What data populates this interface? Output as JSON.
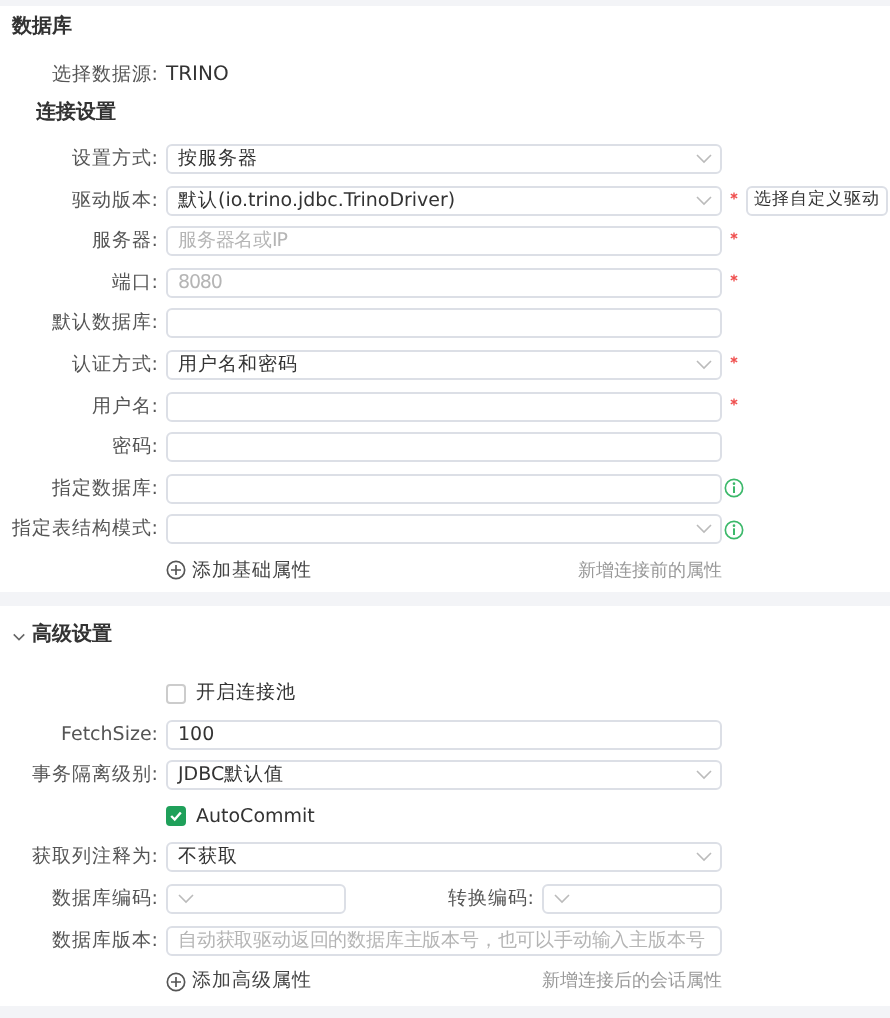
{
  "section_title": "数据库",
  "datasource": {
    "label": "选择数据源:",
    "value": "TRINO"
  },
  "connection": {
    "title": "连接设置",
    "fields": [
      {
        "kind": "select",
        "label": "设置方式:",
        "value": "按服务器",
        "required": false,
        "info": false
      },
      {
        "kind": "select",
        "label": "驱动版本:",
        "value": "默认(io.trino.jdbc.TrinoDriver)",
        "required": true,
        "info": false,
        "button": "选择自定义驱动"
      },
      {
        "kind": "input",
        "label": "服务器:",
        "placeholder": "服务器名或IP",
        "required": true,
        "info": false
      },
      {
        "kind": "input",
        "label": "端口:",
        "placeholder": "8080",
        "required": true,
        "info": false
      },
      {
        "kind": "input",
        "label": "默认数据库:",
        "required": false,
        "info": false
      },
      {
        "kind": "select",
        "label": "认证方式:",
        "value": "用户名和密码",
        "required": true,
        "info": false
      },
      {
        "kind": "input",
        "label": "用户名:",
        "required": true,
        "info": false
      },
      {
        "kind": "input",
        "label": "密码:",
        "required": false,
        "info": false
      },
      {
        "kind": "input",
        "label": "指定数据库:",
        "required": false,
        "info": true
      },
      {
        "kind": "select",
        "label": "指定表结构模式:",
        "required": false,
        "info": true
      }
    ],
    "add_link": {
      "label": "添加基础属性",
      "hint": "新增连接前的属性"
    }
  },
  "advanced": {
    "title": "高级设置",
    "expanded": true,
    "fields": [
      {
        "kind": "checkbox",
        "label": "开启连接池",
        "checked": false
      },
      {
        "kind": "input",
        "label": "FetchSize:",
        "value": "100"
      },
      {
        "kind": "select",
        "label": "事务隔离级别:",
        "value": "JDBC默认值"
      },
      {
        "kind": "checkbox",
        "label": "AutoCommit",
        "checked": true
      },
      {
        "kind": "select",
        "label": "获取列注释为:",
        "value": "不获取"
      },
      {
        "kind": "pair",
        "label": "数据库编码:",
        "label_2": "转换编码:"
      },
      {
        "kind": "input",
        "label": "数据库版本:",
        "placeholder": "自动获取驱动返回的数据库主版本号，也可以手动输入主版本号"
      }
    ],
    "add_link": {
      "label": "添加高级属性",
      "hint": "新增连接后的会话属性"
    }
  }
}
